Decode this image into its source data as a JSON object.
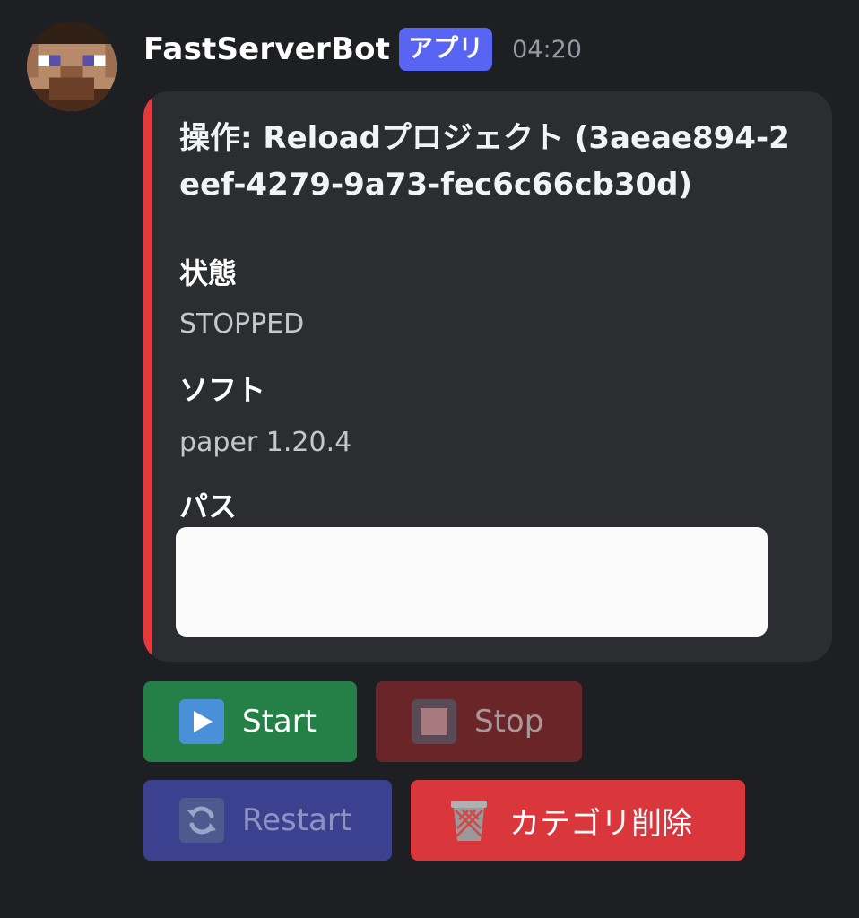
{
  "message": {
    "author": "FastServerBot",
    "app_badge": "アプリ",
    "timestamp": "04:20"
  },
  "embed": {
    "accent_color": "#e5393e",
    "title": "操作: Reloadプロジェクト (3aeae894-2eef-4279-9a73-fec6c66cb30d)",
    "fields": [
      {
        "name": "状態",
        "value": "STOPPED"
      },
      {
        "name": "ソフト",
        "value": "paper 1.20.4"
      },
      {
        "name": "パス",
        "value": ""
      }
    ]
  },
  "buttons": [
    {
      "label": "Start",
      "icon": "play-button-icon",
      "color": "#248046",
      "enabled": true
    },
    {
      "label": "Stop",
      "icon": "stop-button-icon",
      "color": "#da373c",
      "enabled": false
    },
    {
      "label": "Restart",
      "icon": "arrows-counterclockwise-icon",
      "color": "#5865f2",
      "enabled": false
    },
    {
      "label": "カテゴリ削除",
      "icon": "wastebasket-icon",
      "color": "#da373c",
      "enabled": true
    }
  ]
}
